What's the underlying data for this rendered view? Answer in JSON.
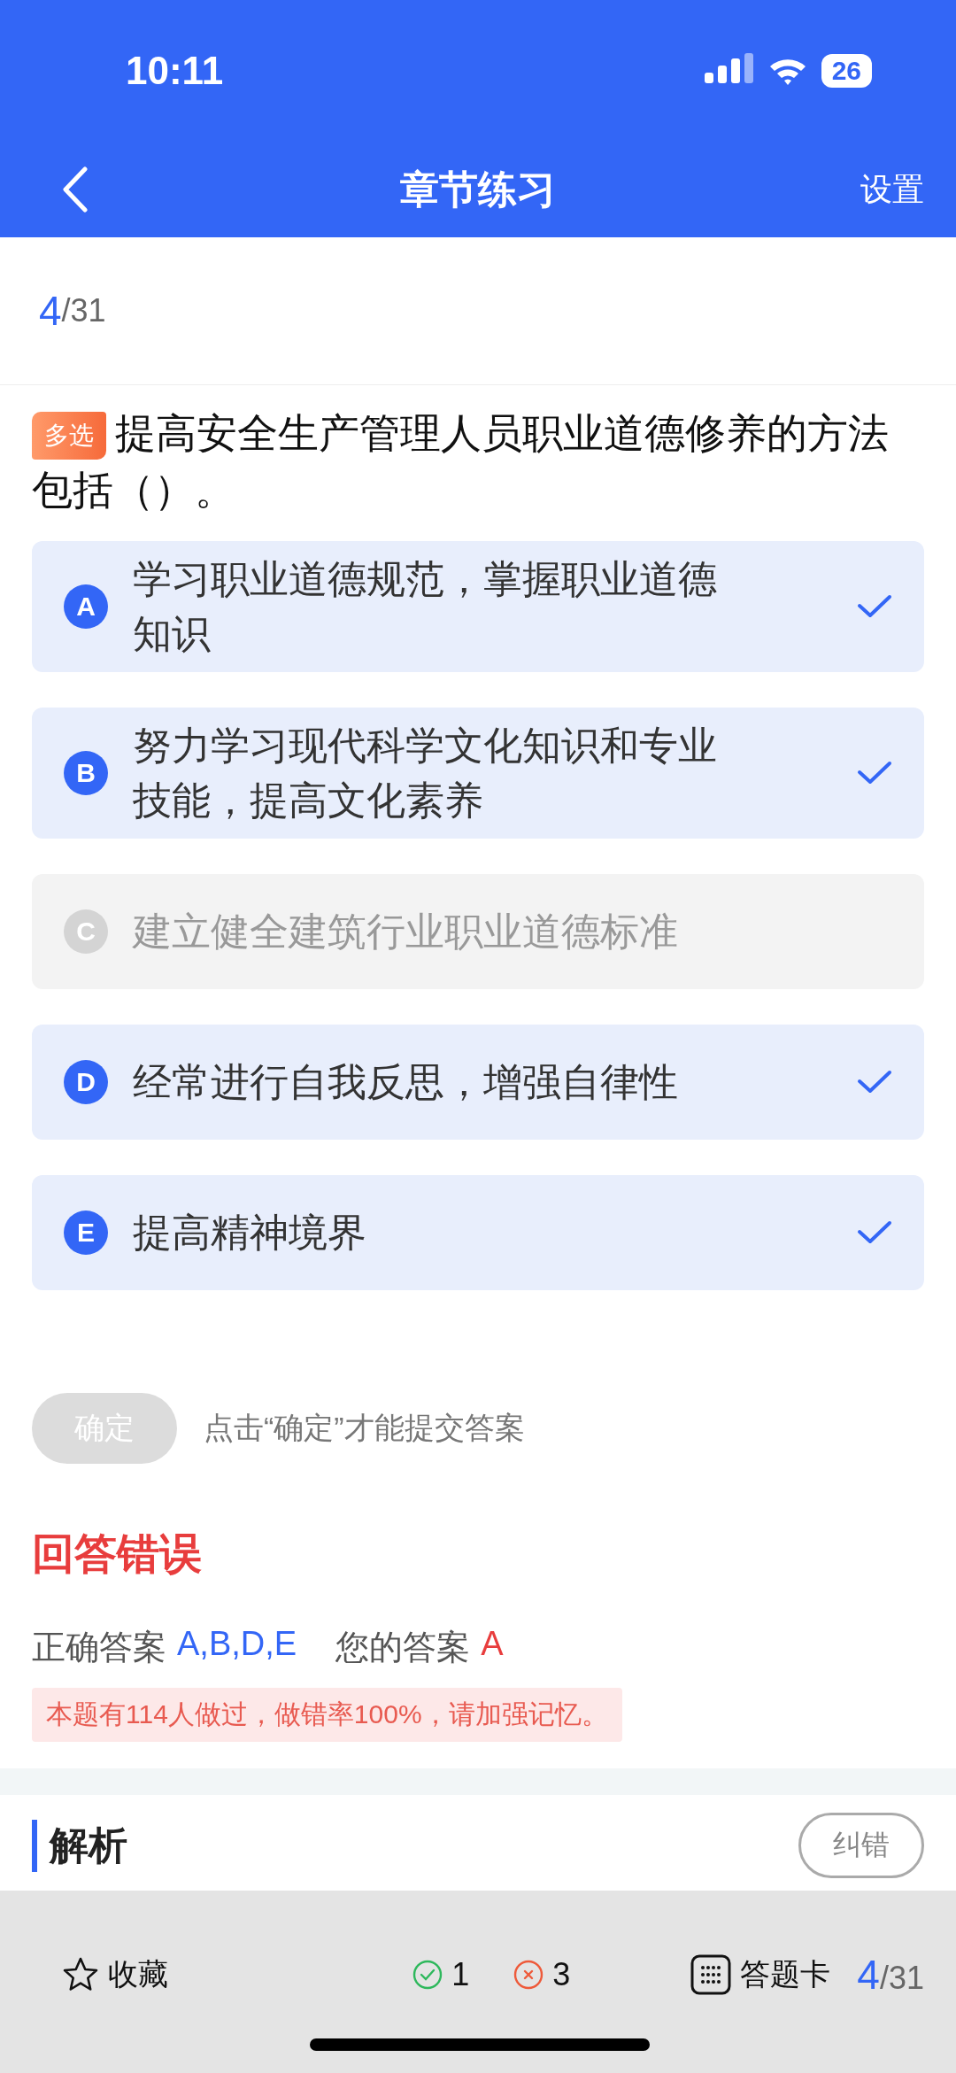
{
  "status_bar": {
    "time": "10:11",
    "battery": "26"
  },
  "header": {
    "title": "章节练习",
    "action": "设置"
  },
  "counter": {
    "current": "4",
    "total": "/31"
  },
  "question": {
    "tag": "多选",
    "text": "提高安全生产管理人员职业道德修养的方法包括（）。"
  },
  "options": [
    {
      "letter": "A",
      "text": "学习职业道德规范，掌握职业道德知识",
      "selected": true
    },
    {
      "letter": "B",
      "text": "努力学习现代科学文化知识和专业技能，提高文化素养",
      "selected": true
    },
    {
      "letter": "C",
      "text": "建立健全建筑行业职业道德标准",
      "selected": false
    },
    {
      "letter": "D",
      "text": "经常进行自我反思，增强自律性",
      "selected": true
    },
    {
      "letter": "E",
      "text": "提高精神境界",
      "selected": true
    }
  ],
  "confirm": {
    "label": "确定",
    "disabled": true,
    "hint": "点击“确定”才能提交答案"
  },
  "result": {
    "title": "回答错误",
    "correct_label": "正确答案",
    "correct": "A,B,D,E",
    "yours_label": "您的答案",
    "yours": "A",
    "notice": "本题有114人做过，做错率100%，请加强记忆。"
  },
  "analysis": {
    "title": "解析",
    "report_button": "纠错"
  },
  "bottom_bar": {
    "favorite": "收藏",
    "right_count": "1",
    "wrong_count": "3",
    "answer_card": "答题卡",
    "current": "4",
    "total": "/31"
  }
}
